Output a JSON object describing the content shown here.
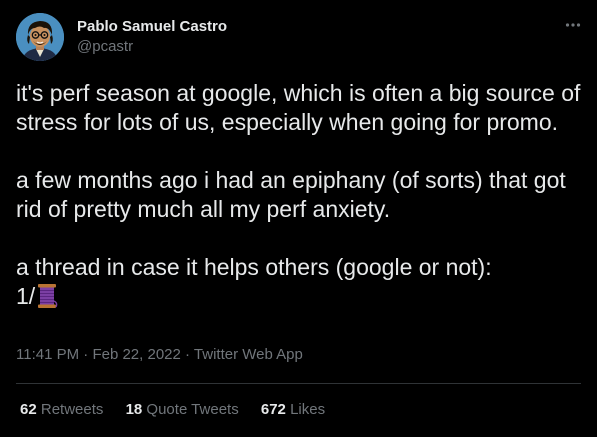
{
  "author": {
    "name": "Pablo Samuel Castro",
    "handle": "@pcastr"
  },
  "more_icon": "more-dots-icon",
  "avatar_icon": "cartoon-avatar",
  "tweet": {
    "paragraphs": [
      "it's perf season at google, which is often a big source of stress for lots of us, especially when going for promo.",
      "a few months ago i had an epiphany (of sorts) that got rid of pretty much all my perf anxiety.",
      "a thread in case it helps others (google or not):"
    ],
    "thread_marker": "1/",
    "thread_emoji": "spool-of-thread"
  },
  "meta": {
    "time": "11:41 PM",
    "sep1": "·",
    "date": "Feb 22, 2022",
    "sep2": "·",
    "source": "Twitter Web App"
  },
  "stats": {
    "retweets": {
      "count": "62",
      "label": "Retweets"
    },
    "quote_tweets": {
      "count": "18",
      "label": "Quote Tweets"
    },
    "likes": {
      "count": "672",
      "label": "Likes"
    }
  },
  "colors": {
    "background": "#000000",
    "text_primary": "#e7e9ea",
    "text_secondary": "#71767b",
    "divider": "#2f3336",
    "avatar_bg": "#4a8fc0"
  }
}
